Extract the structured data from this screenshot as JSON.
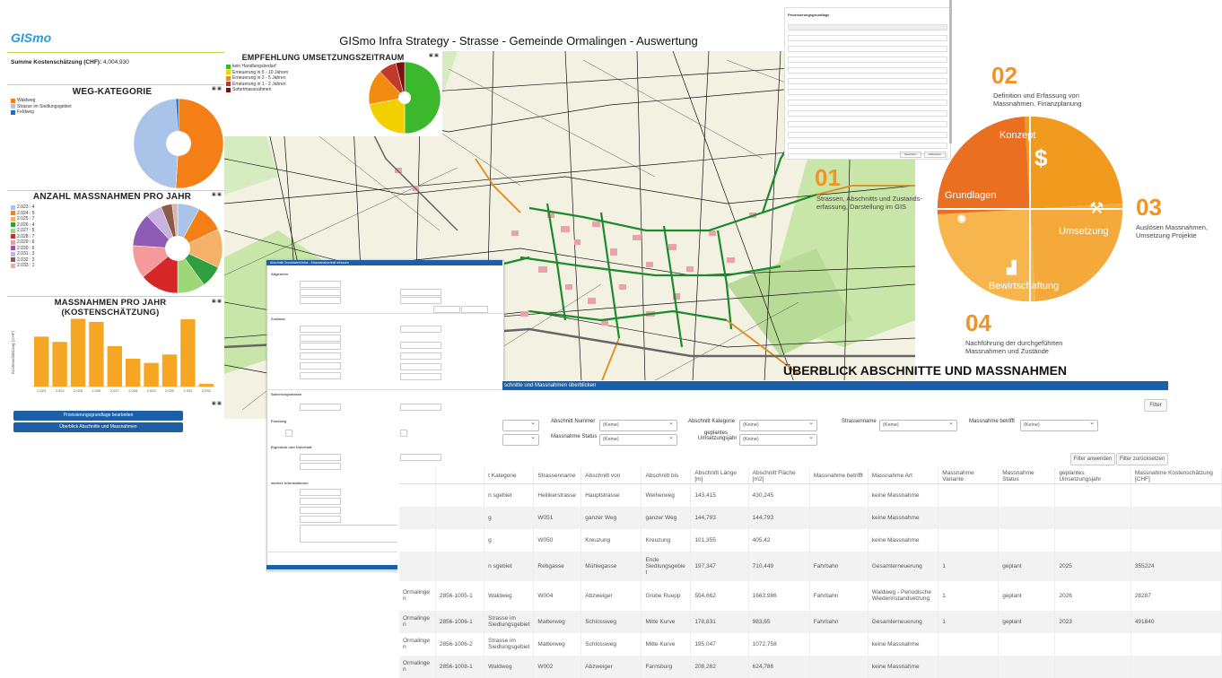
{
  "header": {
    "logo": "GISmo",
    "title": "GISmo Infra Strategy - Strasse - Gemeinde Ormalingen - Auswertung"
  },
  "summary": {
    "label": "Summe Kostenschätzung (CHF):",
    "value": "4,004,930"
  },
  "weg_kategorie": {
    "title": "WEG-KATEGORIE",
    "legend": [
      {
        "label": "Waldweg",
        "color": "#f57f17"
      },
      {
        "label": "Strasse im Siedlungsgebiet",
        "color": "#a9c4e8"
      },
      {
        "label": "Feldweg",
        "color": "#1e73be"
      }
    ]
  },
  "empfehlung": {
    "title": "EMPFEHLUNG UMSETZUNGSZEITRAUM",
    "legend": [
      {
        "label": "kein Handlungsbedarf",
        "color": "#3cb82c"
      },
      {
        "label": "Erneuerung in 5 - 10 Jahren",
        "color": "#f2d000"
      },
      {
        "label": "Erneuerung in 2 - 5 Jahren",
        "color": "#f28c10"
      },
      {
        "label": "Erneuerung in 1 - 2 Jahren",
        "color": "#c0392b"
      },
      {
        "label": "Sofortmassnahmen",
        "color": "#7b1010"
      }
    ]
  },
  "anzahl": {
    "title": "ANZAHL MASSNAHMEN PRO JAHR",
    "legend": [
      {
        "label": "2.023 : 4",
        "color": "#a9c4e8"
      },
      {
        "label": "2.024 : 5",
        "color": "#f57f17"
      },
      {
        "label": "2.025 : 7",
        "color": "#f5b06a"
      },
      {
        "label": "2.026 : 4",
        "color": "#2e9e3e"
      },
      {
        "label": "2.027 : 5",
        "color": "#9ed67a"
      },
      {
        "label": "2.028 : 7",
        "color": "#d62728"
      },
      {
        "label": "2.029 : 6",
        "color": "#f59a9a"
      },
      {
        "label": "2.030 : 6",
        "color": "#8e5bb5"
      },
      {
        "label": "2.031 : 3",
        "color": "#c9b2de"
      },
      {
        "label": "2.032 : 2",
        "color": "#8b5a4a"
      },
      {
        "label": "2.033 : 1",
        "color": "#d7b5a8"
      }
    ]
  },
  "kosten": {
    "title": "MASSNAHMEN PRO JAHR (KOSTENSCHÄTZUNG)",
    "ylabel": "Kostenschätzung (CHF)"
  },
  "chart_data": [
    {
      "type": "bar",
      "title": "MASSNAHMEN PRO JAHR (KOSTENSCHÄTZUNG)",
      "ylabel": "Kostenschätzung (CHF)",
      "categories": [
        "2,023",
        "2,024",
        "2,025",
        "2,026",
        "2,027",
        "2,028",
        "2,029",
        "2,030",
        "2,031",
        "2,032"
      ],
      "values": [
        475,
        425,
        645,
        615,
        385,
        265,
        225,
        305,
        640,
        25
      ],
      "ylim": [
        0,
        700
      ]
    },
    {
      "type": "pie",
      "title": "WEG-KATEGORIE",
      "categories": [
        "Waldweg",
        "Strasse im Siedlungsgebiet",
        "Feldweg"
      ],
      "values": [
        51,
        48,
        1
      ]
    },
    {
      "type": "pie",
      "title": "EMPFEHLUNG UMSETZUNGSZEITRAUM",
      "categories": [
        "kein Handlungsbedarf",
        "Erneuerung in 5 - 10 Jahren",
        "Erneuerung in 2 - 5 Jahren",
        "Erneuerung in 1 - 2 Jahren",
        "Sofortmassnahmen"
      ],
      "values": [
        50,
        22,
        16,
        8,
        4
      ]
    },
    {
      "type": "pie",
      "title": "ANZAHL MASSNAHMEN PRO JAHR",
      "categories": [
        "2.023",
        "2.024",
        "2.025",
        "2.026",
        "2.027",
        "2.028",
        "2.029",
        "2.030",
        "2.031",
        "2.032",
        "2.033"
      ],
      "values": [
        4,
        5,
        7,
        4,
        5,
        7,
        6,
        6,
        3,
        2,
        1
      ]
    }
  ],
  "buttons": {
    "prio": "Priorisierungsgrundlage bearbeiten",
    "overview": "Überblick Abschnitte und Massnahmen"
  },
  "steps": [
    {
      "num": "01",
      "text": "Strassen, Abschnitts und Zustands-erfassung, Darstellung im GIS"
    },
    {
      "num": "02",
      "text": "Definition und Erfassung von Massnahmen, Finanzplanung"
    },
    {
      "num": "03",
      "text": "Auslösen Massnahmen, Umsetzung Projekte"
    },
    {
      "num": "04",
      "text": "Nachführung der durchgeführten Massnahmen und Zustände"
    }
  ],
  "puzzle": {
    "konzept": "Konzept",
    "grundlagen": "Grundlagen",
    "umsetzung": "Umsetzung",
    "bewirtschaftung": "Bewirtschaftung"
  },
  "overview": {
    "title": "ÜBERBLICK ABSCHNITTE UND MASSNAHMEN",
    "bar": "schnitte und Massnahmen überblicken",
    "filter_btn": "Filter",
    "apply": "Filter anwenden",
    "reset": "Filter zurücksetzen",
    "filters": [
      {
        "label": "Abschnitt Nummer",
        "value": "(Keine)"
      },
      {
        "label": "Abschnitt Kategorie",
        "value": "(Keine)"
      },
      {
        "label": "Strassenname",
        "value": "(Keine)"
      },
      {
        "label": "Massnahme betrifft",
        "value": "(Keine)"
      },
      {
        "label": "Massnahme Status",
        "value": "(Keine)"
      },
      {
        "label": "geplantes Umsetzungsjahr",
        "value": "(Keine)"
      }
    ],
    "columns": [
      "",
      "",
      "t Kategorie",
      "Strassenname",
      "Abschnitt von",
      "Abschnitt bis",
      "Abschnitt Länge [m]",
      "Abschnitt Fläche [m2]",
      "Massnahme betrifft",
      "Massnahme Art",
      "Massnahme Variante",
      "Massnahme Status",
      "geplantes Umsetzungsjahr",
      "Massnahme Kostenschätzung [CHF]"
    ],
    "rows": [
      [
        "",
        "",
        "n\nsgebiet",
        "Heilikerstrasse",
        "Hauptstrasse",
        "Weiherweg",
        "143,415",
        "430,245",
        "",
        "keine Massnahme",
        "",
        "",
        "",
        ""
      ],
      [
        "",
        "",
        "g",
        "W051",
        "ganzer Weg",
        "ganzer Weg",
        "144,793",
        "144,793",
        "",
        "keine Massnahme",
        "",
        "",
        "",
        ""
      ],
      [
        "",
        "",
        "g",
        "W050",
        "Kreuzung",
        "Kreuzung",
        "101,355",
        "405,42",
        "",
        "keine Massnahme",
        "",
        "",
        "",
        ""
      ],
      [
        "",
        "",
        "n\nsgebiet",
        "Rebgasse",
        "Mühlegasse",
        "Ende Siedlungsgebie t",
        "197,347",
        "710,449",
        "Fahrbahn",
        "Gesamterneuerung",
        "1",
        "geplant",
        "2025",
        "355224"
      ],
      [
        "Ormalinge n",
        "2856-1005-1",
        "Waldweg",
        "W004",
        "Abzweiger",
        "Grube Ruepp",
        "554,662",
        "1663,986",
        "Fahrbahn",
        "Waldweg - Periodische Wiederinstandsetzung",
        "1",
        "geplant",
        "2026",
        "28287"
      ],
      [
        "Ormalinge n",
        "2856-1006-1",
        "Strasse im Siedlungsgebiet",
        "Matterweg",
        "Schlossweg",
        "Mitte Kurve",
        "178,831",
        "983,65",
        "Fahrbahn",
        "Gesamterneuerung",
        "1",
        "geplant",
        "2023",
        "491840"
      ],
      [
        "Ormalinge n",
        "2856-1006-2",
        "Strasse im Siedlungsgebiet",
        "Matterweg",
        "Schlossweg",
        "Mitte Kurve",
        "195,047",
        "1072,758",
        "",
        "keine Massnahme",
        "",
        "",
        "",
        ""
      ],
      [
        "Ormalinge n",
        "2856-1008-1",
        "Waldweg",
        "W002",
        "Abzweiger",
        "Farnsburg",
        "208,262",
        "624,786",
        "",
        "keine Massnahme",
        "",
        "",
        "",
        ""
      ]
    ]
  },
  "form": {
    "header": "Abschnitt Grunddaten/Infos - Strassenabschnitt erfassen",
    "sections": [
      "Allgemein",
      "Zustand",
      "Sanierungsmasse",
      "Fussweg",
      "Eigentum und Unterhalt",
      "weitere Informationen"
    ],
    "save": "Strassenabschnitt erfassen",
    "cancel": "Abbrechen"
  },
  "prio_panel": {
    "title": "Priorisierungsgrundlage",
    "save": "Speichern",
    "cancel": "Abbrechen"
  }
}
